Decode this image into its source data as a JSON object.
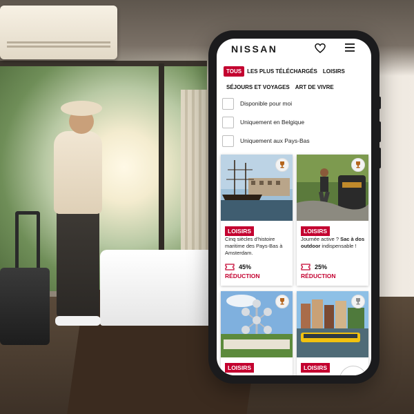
{
  "app": {
    "brand": "NISSAN",
    "accent_color": "#c3002f"
  },
  "header": {
    "favorites_icon": "heart-icon",
    "menu_icon": "hamburger-menu-icon"
  },
  "tabs": [
    {
      "label": "TOUS",
      "active": true
    },
    {
      "label": "LES PLUS TÉLÉCHARGÉS",
      "active": false
    },
    {
      "label": "LOISIRS",
      "active": false
    },
    {
      "label": "SÉJOURS ET VOYAGES",
      "active": false
    },
    {
      "label": "ART DE VIVRE",
      "active": false
    }
  ],
  "checkboxes": [
    {
      "label": "Disponible pour moi",
      "checked": false
    },
    {
      "label": "Uniquement en Belgique",
      "checked": false
    },
    {
      "label": "Uniquement aux Pays-Bas",
      "checked": false
    }
  ],
  "cards": [
    {
      "category": "LOISIRS",
      "text": "Cinq siècles d'histoire maritime des Pays-Bas à Amsterdam.",
      "discount": "45%",
      "discount_label": "RÉDUCTION",
      "trophy": "bronze"
    },
    {
      "category": "LOISIRS",
      "text_plain": "Journée active ? ",
      "text_bold": "Sac à dos outdoor",
      "text_end": " indispensable !",
      "discount": "25%",
      "discount_label": "RÉDUCTION",
      "trophy": "bronze"
    },
    {
      "category": "LOISIRS",
      "trophy": "bronze"
    },
    {
      "category": "LOISIRS",
      "trophy": "silver"
    }
  ]
}
